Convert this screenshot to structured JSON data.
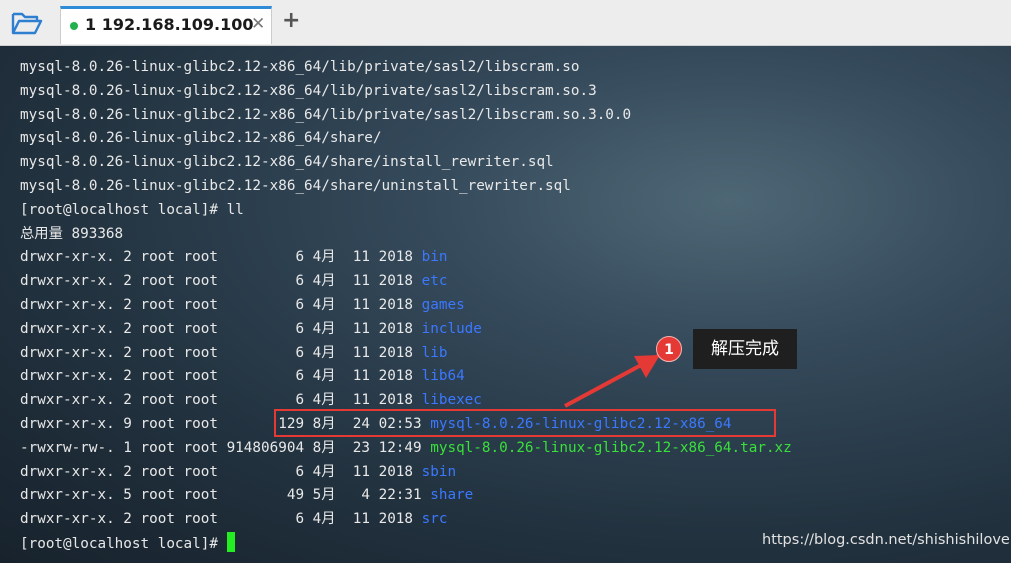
{
  "tab": {
    "title": "1 192.168.109.100",
    "close": "✕"
  },
  "new_tab_label": "+",
  "lines": [
    [
      {
        "t": "mysql-8.0.26-linux-glibc2.12-x86_64/lib/private/sasl2/libscram.so"
      }
    ],
    [
      {
        "t": "mysql-8.0.26-linux-glibc2.12-x86_64/lib/private/sasl2/libscram.so.3"
      }
    ],
    [
      {
        "t": "mysql-8.0.26-linux-glibc2.12-x86_64/lib/private/sasl2/libscram.so.3.0.0"
      }
    ],
    [
      {
        "t": "mysql-8.0.26-linux-glibc2.12-x86_64/share/"
      }
    ],
    [
      {
        "t": "mysql-8.0.26-linux-glibc2.12-x86_64/share/install_rewriter.sql"
      }
    ],
    [
      {
        "t": "mysql-8.0.26-linux-glibc2.12-x86_64/share/uninstall_rewriter.sql"
      }
    ],
    [
      {
        "t": "[root@localhost local]# ll"
      }
    ],
    [
      {
        "t": "总用量 893368"
      }
    ],
    [
      {
        "t": "drwxr-xr-x. 2 root root         6 4月  11 2018 "
      },
      {
        "t": "bin",
        "c": "dir"
      }
    ],
    [
      {
        "t": "drwxr-xr-x. 2 root root         6 4月  11 2018 "
      },
      {
        "t": "etc",
        "c": "dir"
      }
    ],
    [
      {
        "t": "drwxr-xr-x. 2 root root         6 4月  11 2018 "
      },
      {
        "t": "games",
        "c": "dir"
      }
    ],
    [
      {
        "t": "drwxr-xr-x. 2 root root         6 4月  11 2018 "
      },
      {
        "t": "include",
        "c": "dir"
      }
    ],
    [
      {
        "t": "drwxr-xr-x. 2 root root         6 4月  11 2018 "
      },
      {
        "t": "lib",
        "c": "dir"
      }
    ],
    [
      {
        "t": "drwxr-xr-x. 2 root root         6 4月  11 2018 "
      },
      {
        "t": "lib64",
        "c": "dir"
      }
    ],
    [
      {
        "t": "drwxr-xr-x. 2 root root         6 4月  11 2018 "
      },
      {
        "t": "libexec",
        "c": "dir"
      }
    ],
    [
      {
        "t": "drwxr-xr-x. 9 root root       129 8月  24 02:53 "
      },
      {
        "t": "mysql-8.0.26-linux-glibc2.12-x86_64",
        "c": "dir"
      }
    ],
    [
      {
        "t": "-rwxrw-rw-. 1 root root 914806904 8月  23 12:49 "
      },
      {
        "t": "mysql-8.0.26-linux-glibc2.12-x86_64.tar.xz",
        "c": "arc"
      }
    ],
    [
      {
        "t": "drwxr-xr-x. 2 root root         6 4月  11 2018 "
      },
      {
        "t": "sbin",
        "c": "dir"
      }
    ],
    [
      {
        "t": "drwxr-xr-x. 5 root root        49 5月   4 22:31 "
      },
      {
        "t": "share",
        "c": "dir"
      }
    ],
    [
      {
        "t": "drwxr-xr-x. 2 root root         6 4月  11 2018 "
      },
      {
        "t": "src",
        "c": "dir"
      }
    ],
    [
      {
        "t": "[root@localhost local]# "
      }
    ]
  ],
  "annotation": {
    "number": "1",
    "text": "解压完成",
    "highlight_color": "#e53935"
  },
  "watermark": "https://blog.csdn.net/shishishilove",
  "colors": {
    "dir": "#3b78ff",
    "archive": "#39e039",
    "cursor": "#22ee22",
    "tab_accent": "#2e8bd8"
  }
}
